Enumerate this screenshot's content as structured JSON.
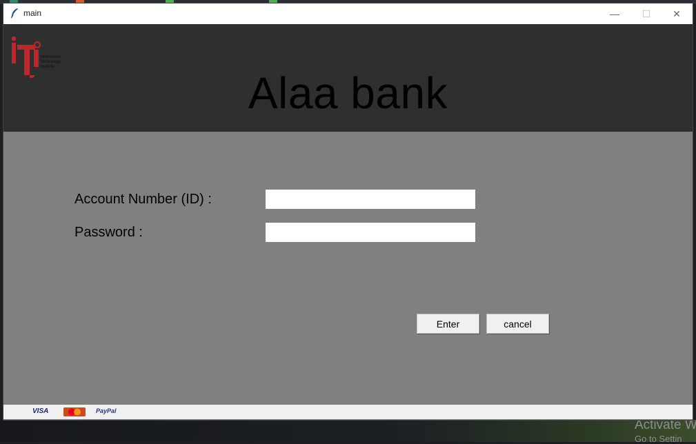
{
  "window": {
    "title": "main",
    "minimize_symbol": "—",
    "maximize_symbol": "☐",
    "close_symbol": "✕"
  },
  "header": {
    "logo_lines": [
      "Information",
      "Technology",
      "Institute"
    ],
    "bank_name": "Alaa bank",
    "colors": {
      "background": "#2f2f2f",
      "logo": "#c0272d"
    }
  },
  "form": {
    "account_label": "Account Number (ID) :",
    "account_value": "",
    "password_label": "Password :",
    "password_value": ""
  },
  "buttons": {
    "enter": "Enter",
    "cancel": "cancel"
  },
  "footer": {
    "payment_methods": [
      "VISA",
      "MasterCard",
      "PayPal"
    ]
  },
  "desktop": {
    "watermark_line1": "Activate W",
    "watermark_line2": "Go to Settin"
  }
}
